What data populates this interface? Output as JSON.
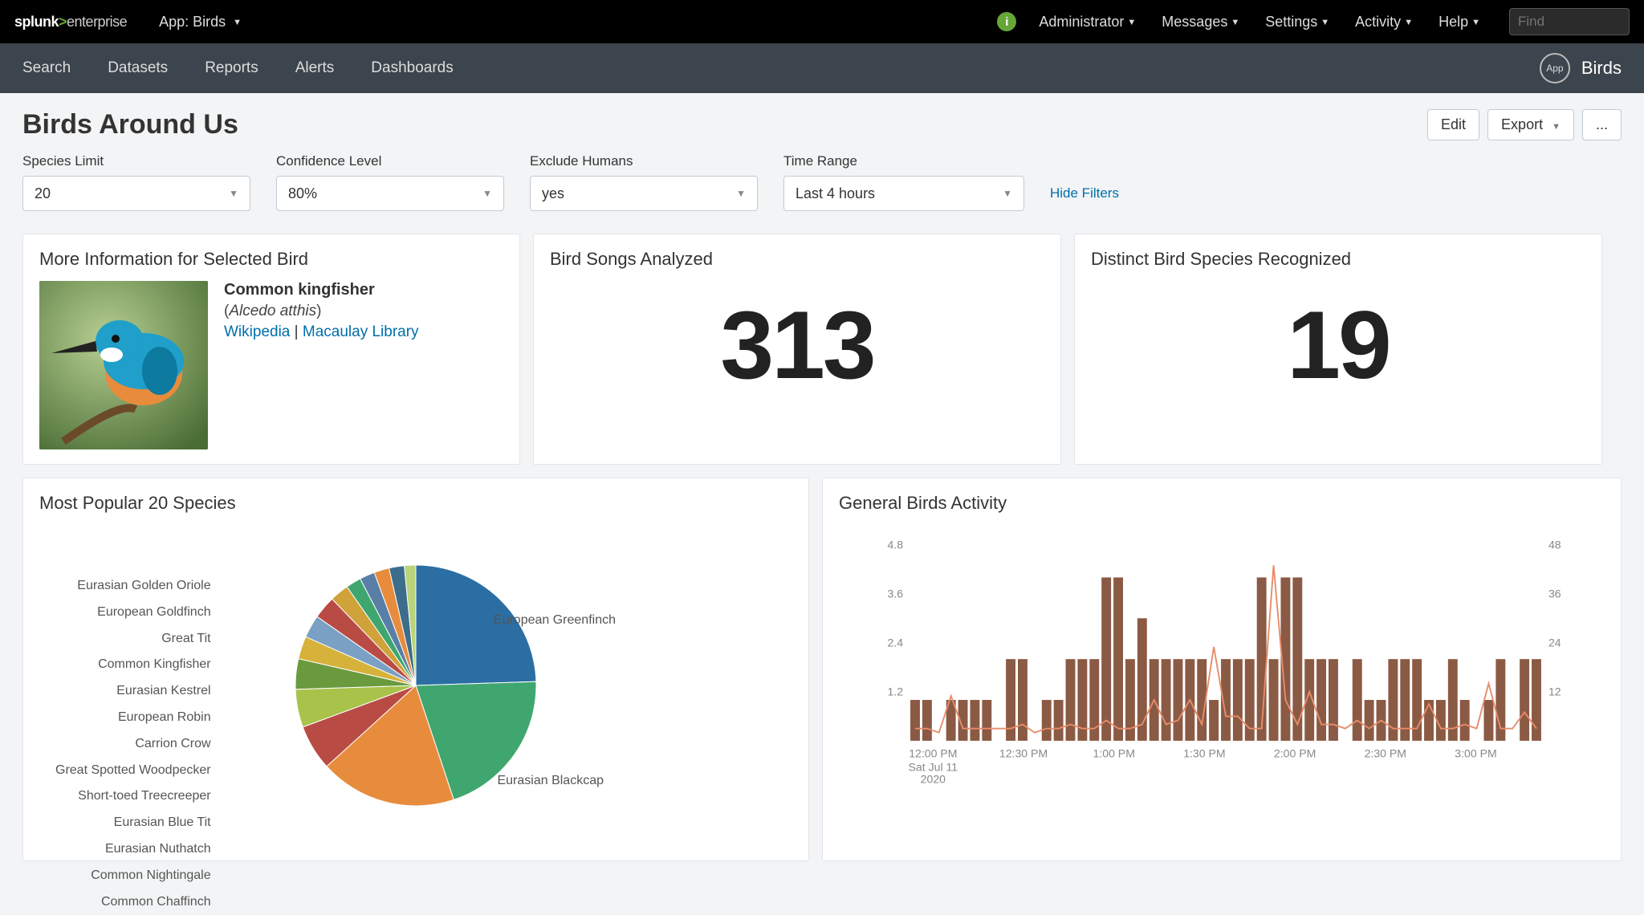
{
  "topbar": {
    "brand_pre": "splunk",
    "brand_gt": ">",
    "brand_post": "enterprise",
    "app_label": "App: Birds",
    "menus": [
      "Administrator",
      "Messages",
      "Settings",
      "Activity",
      "Help"
    ],
    "search_placeholder": "Find"
  },
  "subnav": {
    "links": [
      "Search",
      "Datasets",
      "Reports",
      "Alerts",
      "Dashboards"
    ],
    "app_badge": "App",
    "app_name": "Birds"
  },
  "page": {
    "title": "Birds Around Us",
    "edit": "Edit",
    "export": "Export",
    "more": "..."
  },
  "filters": {
    "species_limit": {
      "label": "Species Limit",
      "value": "20"
    },
    "confidence": {
      "label": "Confidence Level",
      "value": "80%"
    },
    "exclude_humans": {
      "label": "Exclude Humans",
      "value": "yes"
    },
    "time_range": {
      "label": "Time Range",
      "value": "Last 4 hours"
    },
    "hide": "Hide Filters"
  },
  "panels": {
    "bird_info": {
      "title": "More Information for Selected Bird",
      "common_name": "Common kingfisher",
      "sci_open": "(",
      "sci_name": "Alcedo atthis",
      "sci_close": ")",
      "link1": "Wikipedia",
      "link_sep": " | ",
      "link2": "Macaulay Library"
    },
    "songs": {
      "title": "Bird Songs Analyzed",
      "value": "313"
    },
    "species": {
      "title": "Distinct Bird Species Recognized",
      "value": "19"
    },
    "pie": {
      "title": "Most Popular 20 Species"
    },
    "activity": {
      "title": "General Birds Activity"
    }
  },
  "chart_data": [
    {
      "type": "pie",
      "title": "Most Popular 20 Species",
      "series": [
        {
          "name": "European Greenfinch",
          "value": 24,
          "color": "#2b6ea3"
        },
        {
          "name": "Eurasian Blackcap",
          "value": 20,
          "color": "#3fa66f"
        },
        {
          "name": "Common Chaffinch",
          "value": 18,
          "color": "#e78c3c"
        },
        {
          "name": "Common Nightingale",
          "value": 6,
          "color": "#b94b45"
        },
        {
          "name": "Eurasian Nuthatch",
          "value": 5,
          "color": "#a9c24a"
        },
        {
          "name": "Eurasian Blue Tit",
          "value": 4,
          "color": "#6a9a3e"
        },
        {
          "name": "Short-toed Treecreeper",
          "value": 3,
          "color": "#d6b23a"
        },
        {
          "name": "Great Spotted Woodpecker",
          "value": 3,
          "color": "#7aa0c4"
        },
        {
          "name": "Carrion Crow",
          "value": 3,
          "color": "#b94b45"
        },
        {
          "name": "European Robin",
          "value": 2.5,
          "color": "#cfa23a"
        },
        {
          "name": "Eurasian Kestrel",
          "value": 2,
          "color": "#3fa66f"
        },
        {
          "name": "Common Kingfisher",
          "value": 2,
          "color": "#5a7fa6"
        },
        {
          "name": "Great Tit",
          "value": 2,
          "color": "#e78c3c"
        },
        {
          "name": "European Goldfinch",
          "value": 2,
          "color": "#3c6d8a"
        },
        {
          "name": "Eurasian Golden Oriole",
          "value": 1.5,
          "color": "#b9d47a"
        }
      ],
      "right_labels": [
        "European Greenfinch",
        "Eurasian Blackcap"
      ],
      "left_labels": [
        "Eurasian Golden Oriole",
        "European Goldfinch",
        "Great Tit",
        "Common Kingfisher",
        "Eurasian Kestrel",
        "European Robin",
        "Carrion Crow",
        "Great Spotted Woodpecker",
        "Short-toed Treecreeper",
        "Eurasian Blue Tit",
        "Eurasian Nuthatch",
        "Common Nightingale",
        "Common Chaffinch"
      ]
    },
    {
      "type": "bar+line",
      "title": "General Birds Activity",
      "y_left": {
        "min": 0,
        "max": 4.8,
        "ticks": [
          1.2,
          2.4,
          3.6,
          4.8
        ]
      },
      "y_right": {
        "min": 0,
        "max": 48,
        "ticks": [
          12,
          24,
          36,
          48
        ]
      },
      "x_ticks": [
        "12:00 PM",
        "12:30 PM",
        "1:00 PM",
        "1:30 PM",
        "2:00 PM",
        "2:30 PM",
        "3:00 PM"
      ],
      "x_sub": "Sat Jul 11",
      "x_sub2": "2020",
      "bar_color": "#8b5a44",
      "line_color": "#e78c6a",
      "bars": [
        1,
        1,
        0,
        1,
        1,
        1,
        1,
        0,
        2,
        2,
        0,
        1,
        1,
        2,
        2,
        2,
        4,
        4,
        2,
        3,
        2,
        2,
        2,
        2,
        2,
        1,
        2,
        2,
        2,
        4,
        2,
        4,
        4,
        2,
        2,
        2,
        0,
        2,
        1,
        1,
        2,
        2,
        2,
        1,
        1,
        2,
        1,
        0,
        1,
        2,
        0,
        2,
        2
      ],
      "line": [
        0.3,
        0.3,
        0.2,
        1.1,
        0.3,
        0.3,
        0.3,
        0.3,
        0.3,
        0.4,
        0.2,
        0.3,
        0.3,
        0.4,
        0.3,
        0.3,
        0.5,
        0.3,
        0.3,
        0.4,
        1.0,
        0.4,
        0.5,
        1.0,
        0.4,
        2.3,
        0.6,
        0.6,
        0.3,
        0.3,
        4.3,
        1.0,
        0.4,
        1.2,
        0.4,
        0.4,
        0.3,
        0.5,
        0.3,
        0.5,
        0.3,
        0.3,
        0.3,
        0.9,
        0.3,
        0.3,
        0.4,
        0.3,
        1.4,
        0.3,
        0.3,
        0.7,
        0.3
      ]
    }
  ]
}
